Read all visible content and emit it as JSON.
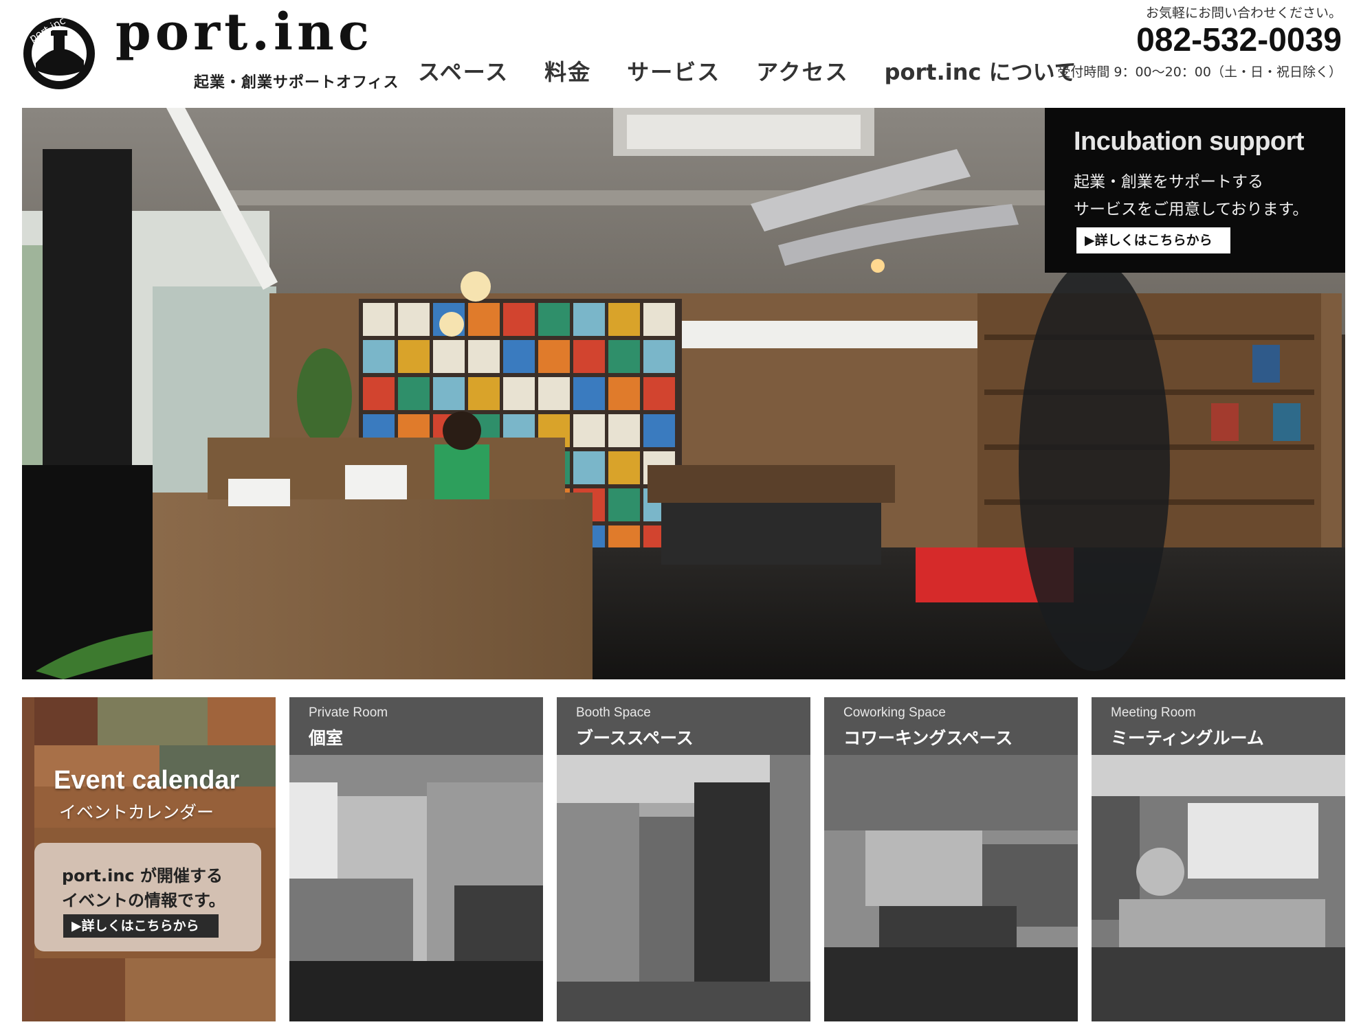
{
  "header": {
    "logo_text": "port.inc",
    "logo_badge_text": "port.inc",
    "tagline": "起業・創業サポートオフィス",
    "nav": [
      {
        "label": "スペース"
      },
      {
        "label": "料金"
      },
      {
        "label": "サービス"
      },
      {
        "label": "アクセス"
      },
      {
        "label": "port.inc について"
      }
    ],
    "contact": {
      "lead": "お気軽にお問い合わせください。",
      "phone": "082-532-0039",
      "hours": "受付時間 9：00～20：00（土・日・祝日除く）"
    }
  },
  "hero": {
    "incubation": {
      "title": "Incubation support",
      "line1": "起業・創業をサポートする",
      "line2": "サービスをご用意しております。",
      "button": "▶詳しくはこちらから"
    }
  },
  "tiles": {
    "event": {
      "title": "Event calendar",
      "subtitle": "イベントカレンダー",
      "line1": "port.inc が開催する",
      "line2": "イベントの情報です。",
      "button": "▶詳しくはこちらから"
    },
    "items": [
      {
        "en": "Private Room",
        "ja": "個室"
      },
      {
        "en": "Booth Space",
        "ja": "ブーススペース"
      },
      {
        "en": "Coworking Space",
        "ja": "コワーキングスペース"
      },
      {
        "en": "Meeting Room",
        "ja": "ミーティングルーム"
      }
    ]
  },
  "colors": {
    "tile_header": "#555555",
    "incubation_bg": "#0a0a0a",
    "accent_red": "#d62a2a"
  }
}
